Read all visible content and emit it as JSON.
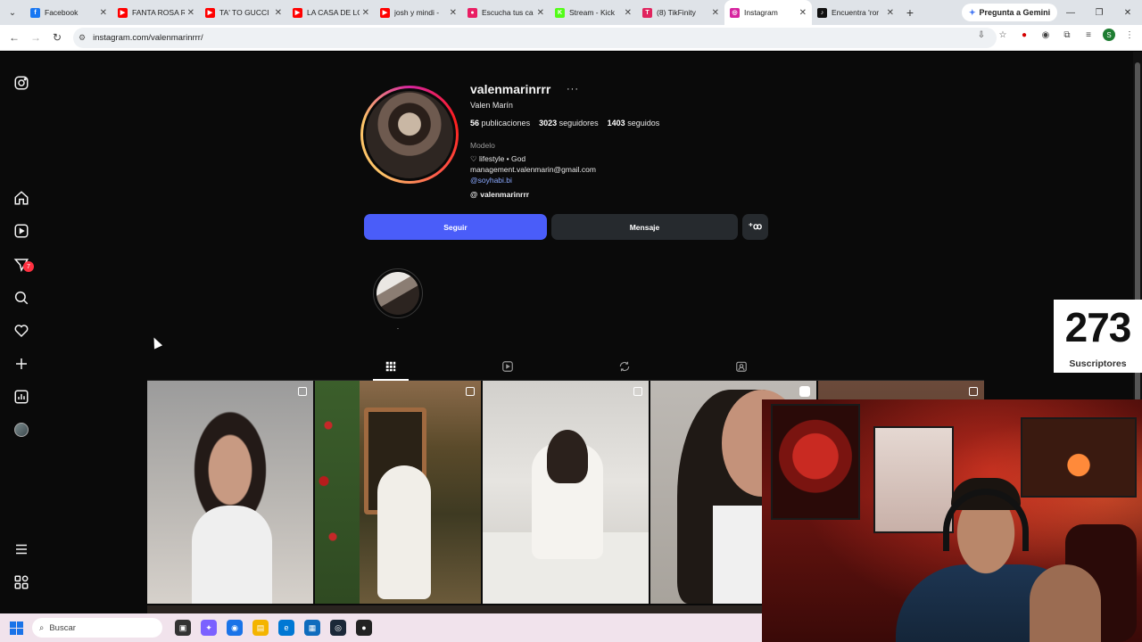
{
  "browser": {
    "tabs": [
      {
        "title": "Facebook",
        "icon": "facebook-icon",
        "color": "#1877f2",
        "glyph": "f"
      },
      {
        "title": "FANTA ROSA R",
        "icon": "youtube-icon",
        "color": "#ff0000",
        "glyph": "▶"
      },
      {
        "title": "TA' TO GUCCI",
        "icon": "youtube-icon",
        "color": "#ff0000",
        "glyph": "▶"
      },
      {
        "title": "LA CASA DE LO",
        "icon": "youtube-icon",
        "color": "#ff0000",
        "glyph": "▶"
      },
      {
        "title": "josh y mindi -",
        "icon": "youtube-icon",
        "color": "#ff0000",
        "glyph": "▶"
      },
      {
        "title": "Escucha tus ca",
        "icon": "music-icon",
        "color": "#e91e63",
        "glyph": "●"
      },
      {
        "title": "Stream - Kick",
        "icon": "kick-icon",
        "color": "#53fc18",
        "glyph": "K"
      },
      {
        "title": "(8) TikFinity",
        "icon": "tikfinity-icon",
        "color": "#e0245e",
        "glyph": "T"
      },
      {
        "title": "Instagram",
        "icon": "instagram-icon",
        "color": "#d6249f",
        "glyph": "◎",
        "active": true
      },
      {
        "title": "Encuentra 'ror",
        "icon": "tiktok-icon",
        "color": "#111111",
        "glyph": "♪"
      }
    ],
    "gemini_label": "Pregunta a Gemini",
    "url": "instagram.com/valenmarinrrr/"
  },
  "profile": {
    "username": "valenmarinrrr",
    "full_name": "Valen Marín",
    "stats": {
      "posts": "56",
      "posts_label": "publicaciones",
      "followers": "3023",
      "followers_label": "seguidores",
      "following": "1403",
      "following_label": "seguidos"
    },
    "category": "Modelo",
    "bio_line1": "♡ lifestyle • God",
    "bio_line2": "management.valenmarin@gmail.com",
    "bio_link": "@soyhabi.bi",
    "threads_handle": "valenmarinrrr",
    "follow_label": "Seguir",
    "message_label": "Mensaje",
    "highlight_label": "."
  },
  "sidebar": {
    "notification_count": "7"
  },
  "overlay": {
    "subscriber_count": "273",
    "subscriber_label": "Suscriptores"
  },
  "taskbar": {
    "search_placeholder": "Buscar"
  },
  "colors": {
    "follow_button": "#4a5df9",
    "link": "#8aa9ff",
    "page_bg": "#0a0a0a"
  }
}
